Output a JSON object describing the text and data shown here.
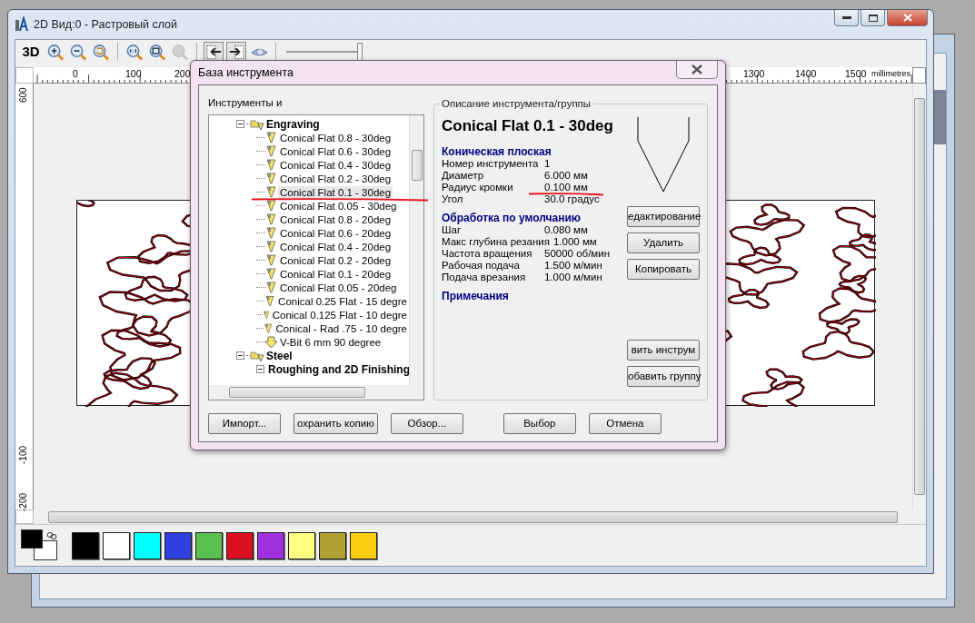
{
  "main_window": {
    "title": "2D Вид:0 - Растровый слой"
  },
  "toolbar": [
    {
      "kind": "text",
      "label": "3D",
      "pressed": false,
      "disabled": false
    },
    {
      "kind": "zoom-in",
      "pressed": false,
      "disabled": false
    },
    {
      "kind": "zoom-out",
      "pressed": false,
      "disabled": false
    },
    {
      "kind": "zoom-previous",
      "pressed": false,
      "disabled": false
    },
    {
      "kind": "separator"
    },
    {
      "kind": "zoom-actual",
      "pressed": false,
      "disabled": false
    },
    {
      "kind": "zoom-fit",
      "pressed": false,
      "disabled": false
    },
    {
      "kind": "zoom-selection",
      "pressed": false,
      "disabled": true
    },
    {
      "kind": "separator"
    },
    {
      "kind": "layer-in",
      "pressed": true,
      "disabled": false
    },
    {
      "kind": "layer-out",
      "pressed": true,
      "disabled": false
    },
    {
      "kind": "view",
      "pressed": false,
      "disabled": false
    },
    {
      "kind": "separator"
    }
  ],
  "zoom_slider": {
    "level": 1
  },
  "ruler": {
    "top_labels": [
      "0",
      "100",
      "200",
      "1300",
      "1400",
      "1500"
    ],
    "unit": "millimetres",
    "left_labels": [
      "600",
      "-100",
      "-200"
    ]
  },
  "palette": {
    "current_colors": [
      {
        "color": "#000000"
      },
      {
        "color": "#ffffff"
      }
    ],
    "swatches": [
      {
        "color": "#000000"
      },
      {
        "color": "#ffffff"
      },
      {
        "color": "#00ffff"
      },
      {
        "color": "#3040e0"
      },
      {
        "color": "#5cc050"
      },
      {
        "color": "#dc1020"
      },
      {
        "color": "#a030e0"
      },
      {
        "color": "#ffff80"
      },
      {
        "color": "#b0a030"
      },
      {
        "color": "#fccc10"
      }
    ]
  },
  "dialog": {
    "title": "База инструмента",
    "tree_label": "Инструменты и",
    "tree": [
      {
        "label": "Engraving",
        "kind": "group",
        "expanded": true,
        "children": [
          {
            "label": "Conical Flat 0.8 - 30deg",
            "kind": "conical",
            "selected": false
          },
          {
            "label": "Conical Flat 0.6 - 30deg",
            "kind": "conical",
            "selected": false
          },
          {
            "label": "Conical Flat 0.4 - 30deg",
            "kind": "conical",
            "selected": false
          },
          {
            "label": "Conical Flat 0.2 - 30deg",
            "kind": "conical",
            "selected": false
          },
          {
            "label": "Conical Flat 0.1 - 30deg",
            "kind": "conical",
            "selected": true
          },
          {
            "label": "Conical Flat 0.05 - 30deg",
            "kind": "conical",
            "selected": false
          },
          {
            "label": "Conical Flat 0.8 - 20deg",
            "kind": "conical",
            "selected": false
          },
          {
            "label": "Conical Flat 0.6 - 20deg",
            "kind": "conical",
            "selected": false
          },
          {
            "label": "Conical Flat 0.4 - 20deg",
            "kind": "conical",
            "selected": false
          },
          {
            "label": "Conical Flat 0.2 - 20deg",
            "kind": "conical",
            "selected": false
          },
          {
            "label": "Conical Flat 0.1 - 20deg",
            "kind": "conical",
            "selected": false
          },
          {
            "label": "Conical Flat 0.05 - 20deg",
            "kind": "conical",
            "selected": false
          },
          {
            "label": "Conical 0.25 Flat - 15 degre",
            "kind": "conical",
            "selected": false
          },
          {
            "label": "Conical 0.125 Flat - 10 degre",
            "kind": "conical",
            "selected": false
          },
          {
            "label": "Conical - Rad .75 - 10 degre",
            "kind": "conical",
            "selected": false
          },
          {
            "label": "V-Bit 6 mm 90 degree",
            "kind": "vbit",
            "selected": false
          }
        ]
      },
      {
        "label": "Steel",
        "kind": "group",
        "expanded": true,
        "children": [
          {
            "label": "Roughing and 2D Finishing",
            "kind": "group",
            "expanded": true
          }
        ]
      }
    ],
    "description": {
      "legend": "Описание инструмента/группы",
      "name": "Conical Flat 0.1 - 30deg",
      "sections": [
        {
          "heading": "Коническая плоская",
          "rows": [
            {
              "label": "Номер инструмента",
              "value": "1"
            },
            {
              "label": "Диаметр",
              "value": "6.000 мм"
            },
            {
              "label": "Радиус кромки",
              "value": "0.100 мм"
            },
            {
              "label": "Угол",
              "value": "30.0 градус"
            }
          ]
        },
        {
          "heading": "Обработка по умолчанию",
          "rows": [
            {
              "label": "Шаг",
              "value": "0.080 мм"
            },
            {
              "label": "Макс глубина резания",
              "value": "1.000 мм"
            },
            {
              "label": "Частота вращения",
              "value": "50000 об/мин"
            },
            {
              "label": "Рабочая подача",
              "value": "1.500 м/мин"
            },
            {
              "label": "Подача врезания",
              "value": "1.000 м/мин"
            }
          ]
        },
        {
          "heading": "Примечания"
        }
      ],
      "side_buttons_top": [
        "едактирование",
        "Удалить",
        "Копировать"
      ],
      "side_buttons_bottom": [
        "вить инструм",
        "обавить группу"
      ]
    },
    "bottom_buttons_left": [
      "Импорт...",
      "охранить копию",
      "Обзор..."
    ],
    "bottom_buttons_right": [
      "Выбор",
      "Отмена"
    ]
  },
  "annotations": [
    {
      "kind": "underline",
      "color": "#e8141c"
    },
    {
      "kind": "underline",
      "color": "#e8141c"
    }
  ]
}
